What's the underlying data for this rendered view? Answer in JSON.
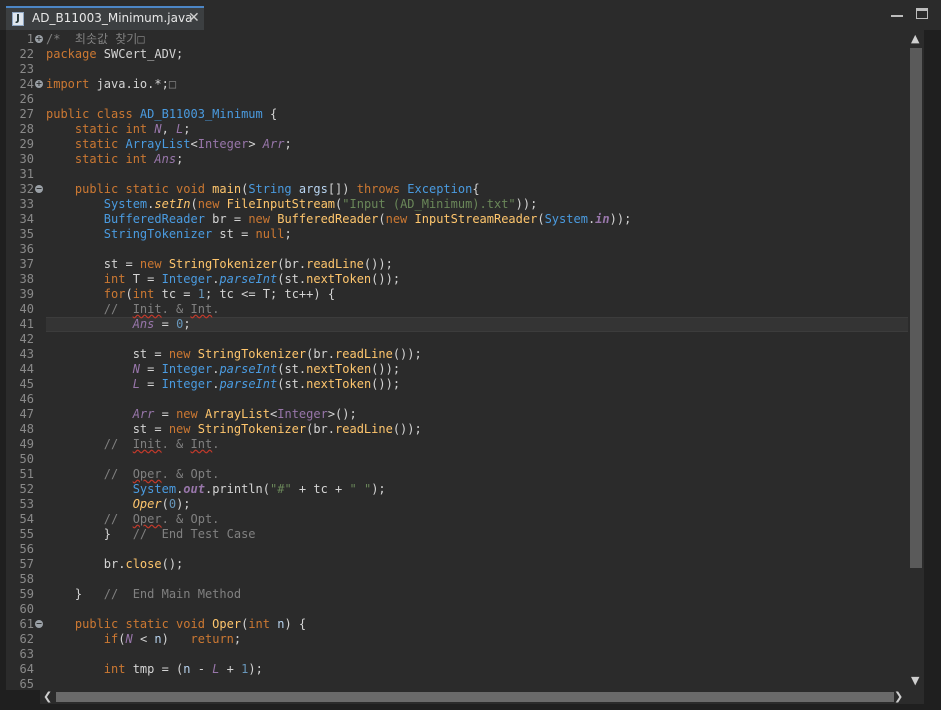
{
  "tab": {
    "title": "AD_B11003_Minimum.java",
    "close": "✕",
    "file_icon": "J"
  },
  "window": {
    "minimize_icon": "minimize-icon",
    "maximize_icon": "maximize-icon"
  },
  "editor": {
    "current_line": "41",
    "lines": [
      {
        "n": "1",
        "fold": "+",
        "t": [
          [
            "/*  최솟값 찾기",
            "cm"
          ],
          [
            "□",
            "cm"
          ]
        ]
      },
      {
        "n": "22",
        "t": [
          [
            "package",
            "kw"
          ],
          [
            " SWCert_ADV;",
            "pl"
          ]
        ]
      },
      {
        "n": "23",
        "t": []
      },
      {
        "n": "24",
        "fold": "+",
        "t": [
          [
            "import",
            "kw"
          ],
          [
            " java.io.*;",
            "pl"
          ],
          [
            "□",
            "cm"
          ]
        ]
      },
      {
        "n": "26",
        "t": []
      },
      {
        "n": "27",
        "t": [
          [
            "public class ",
            "kw"
          ],
          [
            "AD_B11003_Minimum",
            "ty"
          ],
          [
            " {",
            "pl"
          ]
        ]
      },
      {
        "n": "28",
        "t": [
          [
            "    static int ",
            "kw"
          ],
          [
            "N",
            "fi it"
          ],
          [
            ", ",
            "pl"
          ],
          [
            "L",
            "fi it"
          ],
          [
            ";",
            "pl"
          ]
        ]
      },
      {
        "n": "29",
        "t": [
          [
            "    static ",
            "kw"
          ],
          [
            "ArrayList",
            "ty"
          ],
          [
            "<",
            "pl"
          ],
          [
            "Integer",
            "fi"
          ],
          [
            "> ",
            "pl"
          ],
          [
            "Arr",
            "fi it"
          ],
          [
            ";",
            "pl"
          ]
        ]
      },
      {
        "n": "30",
        "t": [
          [
            "    static int ",
            "kw"
          ],
          [
            "Ans",
            "fi it"
          ],
          [
            ";",
            "pl"
          ]
        ]
      },
      {
        "n": "31",
        "t": []
      },
      {
        "n": "32",
        "fold": "−",
        "t": [
          [
            "    public static void ",
            "kw"
          ],
          [
            "main",
            "mt"
          ],
          [
            "(",
            "pl"
          ],
          [
            "String",
            "ty"
          ],
          [
            " ",
            "pl"
          ],
          [
            "args",
            "pm"
          ],
          [
            "[]) ",
            "pl"
          ],
          [
            "throws ",
            "kw"
          ],
          [
            "Exception",
            "ty"
          ],
          [
            "{",
            "pl"
          ]
        ]
      },
      {
        "n": "33",
        "t": [
          [
            "        ",
            "pl"
          ],
          [
            "System",
            "ty"
          ],
          [
            ".",
            "pl"
          ],
          [
            "setIn",
            "mt it"
          ],
          [
            "(",
            "pl"
          ],
          [
            "new ",
            "kw"
          ],
          [
            "FileInputStream",
            "mt"
          ],
          [
            "(",
            "pl"
          ],
          [
            "\"Input (AD_Minimum).txt\"",
            "st"
          ],
          [
            "));",
            "pl"
          ]
        ]
      },
      {
        "n": "34",
        "t": [
          [
            "        ",
            "pl"
          ],
          [
            "BufferedReader",
            "ty"
          ],
          [
            " br = ",
            "pl"
          ],
          [
            "new ",
            "kw"
          ],
          [
            "BufferedReader",
            "mt"
          ],
          [
            "(",
            "pl"
          ],
          [
            "new ",
            "kw"
          ],
          [
            "InputStreamReader",
            "mt"
          ],
          [
            "(",
            "pl"
          ],
          [
            "System",
            "ty"
          ],
          [
            ".",
            "pl"
          ],
          [
            "in",
            "fi it bd"
          ],
          [
            "));",
            "pl"
          ]
        ]
      },
      {
        "n": "35",
        "t": [
          [
            "        ",
            "pl"
          ],
          [
            "StringTokenizer",
            "ty"
          ],
          [
            " st = ",
            "pl"
          ],
          [
            "null",
            "kw"
          ],
          [
            ";",
            "pl"
          ]
        ]
      },
      {
        "n": "36",
        "t": []
      },
      {
        "n": "37",
        "t": [
          [
            "        st = ",
            "pl"
          ],
          [
            "new ",
            "kw"
          ],
          [
            "StringTokenizer",
            "mt"
          ],
          [
            "(br.",
            "pl"
          ],
          [
            "readLine",
            "mt"
          ],
          [
            "());",
            "pl"
          ]
        ]
      },
      {
        "n": "38",
        "t": [
          [
            "        ",
            "pl"
          ],
          [
            "int",
            "kw"
          ],
          [
            " T = ",
            "pl"
          ],
          [
            "Integer",
            "ty"
          ],
          [
            ".",
            "pl"
          ],
          [
            "parseInt",
            "ty it"
          ],
          [
            "(st.",
            "pl"
          ],
          [
            "nextToken",
            "mt"
          ],
          [
            "());",
            "pl"
          ]
        ]
      },
      {
        "n": "39",
        "t": [
          [
            "        ",
            "pl"
          ],
          [
            "for",
            "kw"
          ],
          [
            "(",
            "pl"
          ],
          [
            "int",
            "kw"
          ],
          [
            " tc = ",
            "pl"
          ],
          [
            "1",
            "nm"
          ],
          [
            "; tc <= T; tc++) {",
            "pl"
          ]
        ]
      },
      {
        "n": "40",
        "t": [
          [
            "        //  ",
            "cm"
          ],
          [
            "Init",
            "cm sq"
          ],
          [
            ". & ",
            "cm"
          ],
          [
            "Int",
            "cm sq"
          ],
          [
            ".",
            "cm"
          ]
        ]
      },
      {
        "n": "41",
        "t": [
          [
            "            ",
            "pl"
          ],
          [
            "Ans",
            "fi it"
          ],
          [
            " = ",
            "pl"
          ],
          [
            "0",
            "nm"
          ],
          [
            ";",
            "pl"
          ]
        ]
      },
      {
        "n": "42",
        "t": []
      },
      {
        "n": "43",
        "t": [
          [
            "            st = ",
            "pl"
          ],
          [
            "new ",
            "kw"
          ],
          [
            "StringTokenizer",
            "mt"
          ],
          [
            "(br.",
            "pl"
          ],
          [
            "readLine",
            "mt"
          ],
          [
            "());",
            "pl"
          ]
        ]
      },
      {
        "n": "44",
        "t": [
          [
            "            ",
            "pl"
          ],
          [
            "N",
            "fi it"
          ],
          [
            " = ",
            "pl"
          ],
          [
            "Integer",
            "ty"
          ],
          [
            ".",
            "pl"
          ],
          [
            "parseInt",
            "ty it"
          ],
          [
            "(st.",
            "pl"
          ],
          [
            "nextToken",
            "mt"
          ],
          [
            "());",
            "pl"
          ]
        ]
      },
      {
        "n": "45",
        "t": [
          [
            "            ",
            "pl"
          ],
          [
            "L",
            "fi it"
          ],
          [
            " = ",
            "pl"
          ],
          [
            "Integer",
            "ty"
          ],
          [
            ".",
            "pl"
          ],
          [
            "parseInt",
            "ty it"
          ],
          [
            "(st.",
            "pl"
          ],
          [
            "nextToken",
            "mt"
          ],
          [
            "());",
            "pl"
          ]
        ]
      },
      {
        "n": "46",
        "t": []
      },
      {
        "n": "47",
        "t": [
          [
            "            ",
            "pl"
          ],
          [
            "Arr",
            "fi it"
          ],
          [
            " = ",
            "pl"
          ],
          [
            "new ",
            "kw"
          ],
          [
            "ArrayList",
            "mt"
          ],
          [
            "<",
            "pl"
          ],
          [
            "Integer",
            "fi"
          ],
          [
            ">();",
            "pl"
          ]
        ]
      },
      {
        "n": "48",
        "t": [
          [
            "            st = ",
            "pl"
          ],
          [
            "new ",
            "kw"
          ],
          [
            "StringTokenizer",
            "mt"
          ],
          [
            "(br.",
            "pl"
          ],
          [
            "readLine",
            "mt"
          ],
          [
            "());",
            "pl"
          ]
        ]
      },
      {
        "n": "49",
        "t": [
          [
            "        //  ",
            "cm"
          ],
          [
            "Init",
            "cm sq"
          ],
          [
            ". & ",
            "cm"
          ],
          [
            "Int",
            "cm sq"
          ],
          [
            ".",
            "cm"
          ]
        ]
      },
      {
        "n": "50",
        "t": []
      },
      {
        "n": "51",
        "t": [
          [
            "        //  ",
            "cm"
          ],
          [
            "Oper",
            "cm sq"
          ],
          [
            ". & Opt.",
            "cm"
          ]
        ]
      },
      {
        "n": "52",
        "t": [
          [
            "            ",
            "pl"
          ],
          [
            "System",
            "ty"
          ],
          [
            ".",
            "pl"
          ],
          [
            "out",
            "fi it bd"
          ],
          [
            ".println(",
            "pl"
          ],
          [
            "\"#\"",
            "st"
          ],
          [
            " + tc + ",
            "pl"
          ],
          [
            "\" \"",
            "st"
          ],
          [
            ");",
            "pl"
          ]
        ]
      },
      {
        "n": "53",
        "t": [
          [
            "            ",
            "pl"
          ],
          [
            "Oper",
            "mt it"
          ],
          [
            "(",
            "pl"
          ],
          [
            "0",
            "nm"
          ],
          [
            ");",
            "pl"
          ]
        ]
      },
      {
        "n": "54",
        "t": [
          [
            "        //  ",
            "cm"
          ],
          [
            "Oper",
            "cm sq"
          ],
          [
            ". & Opt.",
            "cm"
          ]
        ]
      },
      {
        "n": "55",
        "t": [
          [
            "        }   ",
            "pl"
          ],
          [
            "//  End Test Case",
            "cm"
          ]
        ]
      },
      {
        "n": "56",
        "t": []
      },
      {
        "n": "57",
        "t": [
          [
            "        br.",
            "pl"
          ],
          [
            "close",
            "mt"
          ],
          [
            "();",
            "pl"
          ]
        ]
      },
      {
        "n": "58",
        "t": []
      },
      {
        "n": "59",
        "t": [
          [
            "    }   ",
            "pl"
          ],
          [
            "//  End Main Method",
            "cm"
          ]
        ]
      },
      {
        "n": "60",
        "t": []
      },
      {
        "n": "61",
        "fold": "−",
        "t": [
          [
            "    public static void ",
            "kw"
          ],
          [
            "Oper",
            "mt"
          ],
          [
            "(",
            "pl"
          ],
          [
            "int",
            "kw"
          ],
          [
            " ",
            "pl"
          ],
          [
            "n",
            "pm"
          ],
          [
            ") {",
            "pl"
          ]
        ]
      },
      {
        "n": "62",
        "t": [
          [
            "        ",
            "pl"
          ],
          [
            "if",
            "kw"
          ],
          [
            "(",
            "pl"
          ],
          [
            "N",
            "fi it"
          ],
          [
            " < ",
            "pl"
          ],
          [
            "n",
            "pm"
          ],
          [
            ")   ",
            "pl"
          ],
          [
            "return",
            "kw"
          ],
          [
            ";",
            "pl"
          ]
        ]
      },
      {
        "n": "63",
        "t": []
      },
      {
        "n": "64",
        "t": [
          [
            "        ",
            "pl"
          ],
          [
            "int",
            "kw"
          ],
          [
            " tmp = (",
            "pl"
          ],
          [
            "n",
            "pm"
          ],
          [
            " - ",
            "pl"
          ],
          [
            "L",
            "fi it"
          ],
          [
            " + ",
            "pl"
          ],
          [
            "1",
            "nm"
          ],
          [
            ");",
            "pl"
          ]
        ]
      },
      {
        "n": "65",
        "t": []
      }
    ]
  },
  "scrollbars": {
    "up": "▲",
    "down": "▼",
    "left": "❮",
    "right": "❯"
  }
}
